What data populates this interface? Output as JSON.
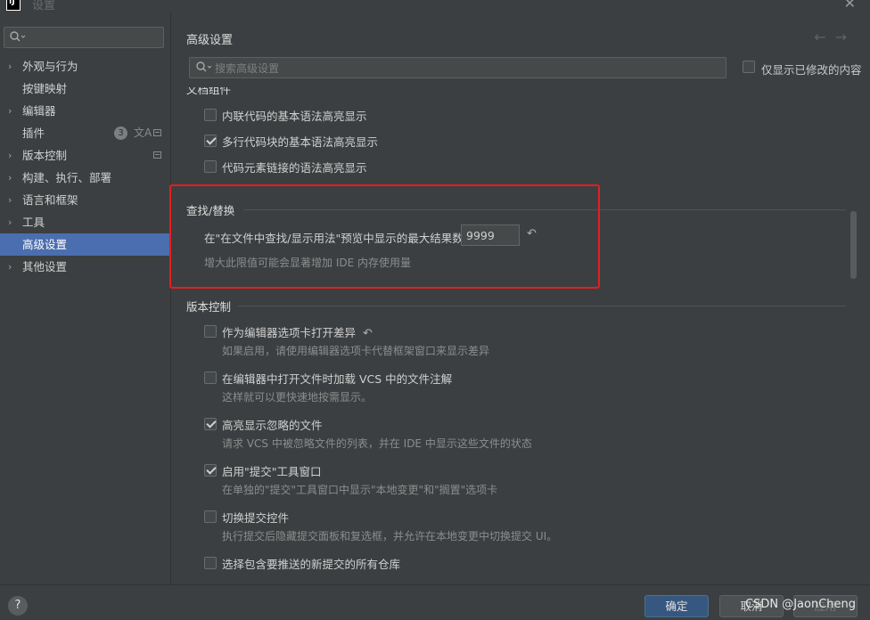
{
  "window": {
    "title": "设置",
    "logo": "IJ"
  },
  "sidebar": {
    "search_placeholder": "",
    "items": [
      {
        "label": "外观与行为",
        "expandable": true
      },
      {
        "label": "按键映射",
        "expandable": false
      },
      {
        "label": "编辑器",
        "expandable": true
      },
      {
        "label": "插件",
        "expandable": false,
        "badge": "3"
      },
      {
        "label": "版本控制",
        "expandable": true
      },
      {
        "label": "构建、执行、部署",
        "expandable": true
      },
      {
        "label": "语言和框架",
        "expandable": true
      },
      {
        "label": "工具",
        "expandable": true
      },
      {
        "label": "高级设置",
        "expandable": false,
        "selected": true
      },
      {
        "label": "其他设置",
        "expandable": true
      }
    ]
  },
  "main": {
    "title": "高级设置",
    "search_placeholder": "搜索高级设置",
    "modified_only_label": "仅显示已修改的内容",
    "partial_section_title": "文档组件",
    "doc_options": [
      {
        "label": "内联代码的基本语法高亮显示",
        "checked": false
      },
      {
        "label": "多行代码块的基本语法高亮显示",
        "checked": true
      },
      {
        "label": "代码元素链接的语法高亮显示",
        "checked": false
      }
    ],
    "find_section": {
      "title": "查找/替换",
      "field_label": "在\"在文件中查找/显示用法\"预览中显示的最大结果数:",
      "field_value": "9999",
      "description": "增大此限值可能会显著增加 IDE 内存使用量"
    },
    "vcs_section": {
      "title": "版本控制",
      "options": [
        {
          "label": "作为编辑器选项卡打开差异",
          "checked": false,
          "description": "如果启用，请使用编辑器选项卡代替框架窗口来显示差异"
        },
        {
          "label": "在编辑器中打开文件时加载 VCS 中的文件注解",
          "checked": false,
          "description": "这样就可以更快速地按需显示。"
        },
        {
          "label": "高亮显示忽略的文件",
          "checked": true,
          "description": "请求 VCS 中被忽略文件的列表，并在 IDE 中显示这些文件的状态"
        },
        {
          "label": "启用\"提交\"工具窗口",
          "checked": true,
          "description": "在单独的\"提交\"工具窗口中显示\"本地变更\"和\"搁置\"选项卡"
        },
        {
          "label": "切换提交控件",
          "checked": false,
          "description": "执行提交后隐藏提交面板和复选框，并允许在本地变更中切换提交 UI。"
        },
        {
          "label": "选择包含要推送的新提交的所有仓库",
          "checked": false,
          "description": ""
        }
      ]
    }
  },
  "footer": {
    "help": "?",
    "ok_label": "确定",
    "cancel_label": "取消",
    "apply_label": "应用",
    "watermark": "CSDN @JaonCheng"
  },
  "colors": {
    "accent": "#4b6eaf",
    "highlight_box": "#e51e1e",
    "background": "#3c3f41"
  }
}
